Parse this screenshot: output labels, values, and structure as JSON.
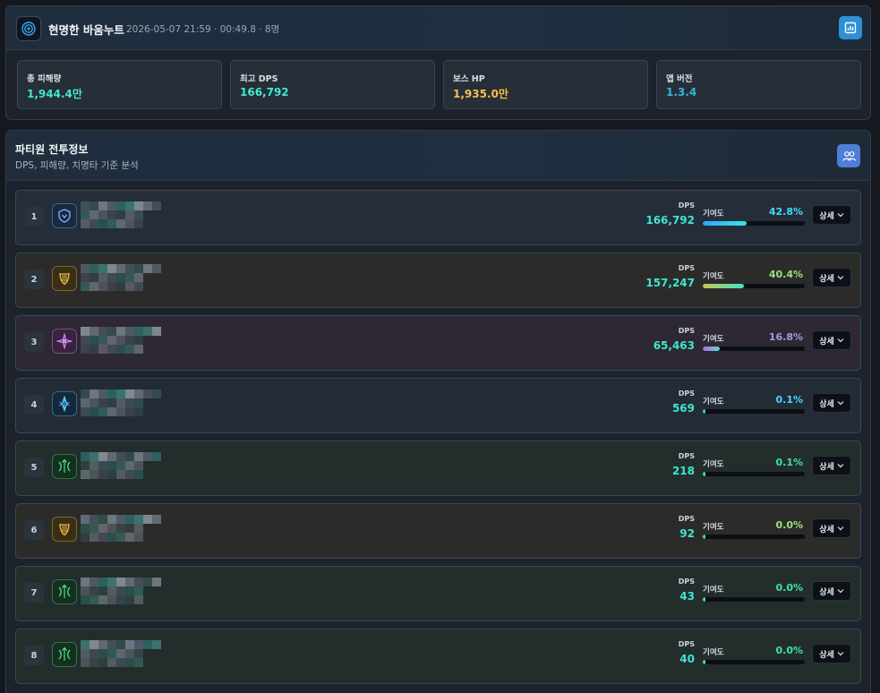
{
  "app": {
    "title": "현명한 바움누트",
    "meta": "2026-05-07 21:59 · 00:49.8 · 8명",
    "logo_icon": "spiral-logo-icon",
    "report_icon": "chart-report-icon"
  },
  "stats": [
    {
      "label": "총 피해량",
      "value": "1,944.4만",
      "color": "#43e7cf"
    },
    {
      "label": "최고 DPS",
      "value": "166,792",
      "color": "#43e7cf"
    },
    {
      "label": "보스 HP",
      "value": "1,935.0만",
      "color": "#f4c04a"
    },
    {
      "label": "앱 버전",
      "value": "1.3.4",
      "color": "#36b6d8"
    }
  ],
  "party": {
    "title": "파티원 전투정보",
    "subtitle": "DPS, 피해량, 치명타 기준 분석",
    "icon": "party-members-icon"
  },
  "labels": {
    "dps": "DPS",
    "contribution": "기여도",
    "detail": "상세"
  },
  "members": [
    {
      "rank": "1",
      "class_icon": "guardian-shield-icon",
      "dps": "166,792",
      "contribution": "42.8%",
      "contribution_value": 0.428,
      "pct_color": "#43d9ff",
      "bar": "linear-gradient(90deg,#2aa8ff,#3be3e0)",
      "bg": "#242d38",
      "icon_color": "#7fb6ff",
      "icon_bg": "#1a2942"
    },
    {
      "rank": "2",
      "class_icon": "golden-lyre-icon",
      "dps": "157,247",
      "contribution": "40.4%",
      "contribution_value": 0.404,
      "pct_color": "#9fe07c",
      "bar": "linear-gradient(90deg,#c8c45a,#3fe3c3)",
      "bg": "#2b2c2a",
      "icon_color": "#e9b94a",
      "icon_bg": "#3a2e14"
    },
    {
      "rank": "3",
      "class_icon": "arcane-star-icon",
      "dps": "65,463",
      "contribution": "16.8%",
      "contribution_value": 0.168,
      "pct_color": "#9f9be8",
      "bar": "linear-gradient(90deg,#b46ee0,#58d6c8)",
      "bg": "#2d2834",
      "icon_color": "#d68cf0",
      "icon_bg": "#3a2340"
    },
    {
      "rank": "4",
      "class_icon": "frost-blade-icon",
      "dps": "569",
      "contribution": "0.1%",
      "contribution_value": 0.001,
      "pct_color": "#43d9ff",
      "bar": "#39c9e8",
      "bg": "#232b35",
      "icon_color": "#61c7ff",
      "icon_bg": "#14283c"
    },
    {
      "rank": "5",
      "class_icon": "ranger-bow-icon",
      "dps": "218",
      "contribution": "0.1%",
      "contribution_value": 0.001,
      "pct_color": "#3ee0a7",
      "bar": "#3ee0a7",
      "bg": "#232d2c",
      "icon_color": "#4ee08e",
      "icon_bg": "#15301f"
    },
    {
      "rank": "6",
      "class_icon": "golden-lyre-icon",
      "dps": "92",
      "contribution": "0.0%",
      "contribution_value": 0.0,
      "pct_color": "#9fe07c",
      "bar": "#3ee0a7",
      "bg": "#2b2c2a",
      "icon_color": "#e9b94a",
      "icon_bg": "#3a2e14"
    },
    {
      "rank": "7",
      "class_icon": "ranger-bow-icon",
      "dps": "43",
      "contribution": "0.0%",
      "contribution_value": 0.0,
      "pct_color": "#3ee0a7",
      "bar": "#3ee0a7",
      "bg": "#232d2c",
      "icon_color": "#4ee08e",
      "icon_bg": "#15301f"
    },
    {
      "rank": "8",
      "class_icon": "ranger-bow-icon",
      "dps": "40",
      "contribution": "0.0%",
      "contribution_value": 0.0,
      "pct_color": "#3ee0a7",
      "bar": "#3ee0a7",
      "bg": "#232d2c",
      "icon_color": "#4ee08e",
      "icon_bg": "#15301f"
    }
  ]
}
